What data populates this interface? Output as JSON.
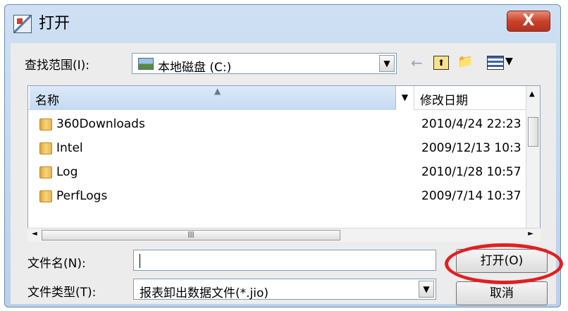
{
  "window": {
    "title": "打开",
    "close_label": "X"
  },
  "lookin": {
    "label": "查找范围(I):",
    "value": "本地磁盘 (C:)"
  },
  "columns": {
    "name": "名称",
    "date": "修改日期"
  },
  "files": [
    {
      "name": "360Downloads",
      "date": "2010/4/24 22:23"
    },
    {
      "name": "Intel",
      "date": "2009/12/13 10:3"
    },
    {
      "name": "Log",
      "date": "2010/1/28 10:57"
    },
    {
      "name": "PerfLogs",
      "date": "2009/7/14 10:37"
    }
  ],
  "filename": {
    "label": "文件名(N):",
    "value": ""
  },
  "filetype": {
    "label": "文件类型(T):",
    "value": "报表卸出数据文件(*.jio)"
  },
  "buttons": {
    "open": "打开(O)",
    "cancel": "取消"
  },
  "colors": {
    "highlight": "#e02020",
    "titlebar": "#cfe0f3",
    "close": "#c9432c"
  }
}
